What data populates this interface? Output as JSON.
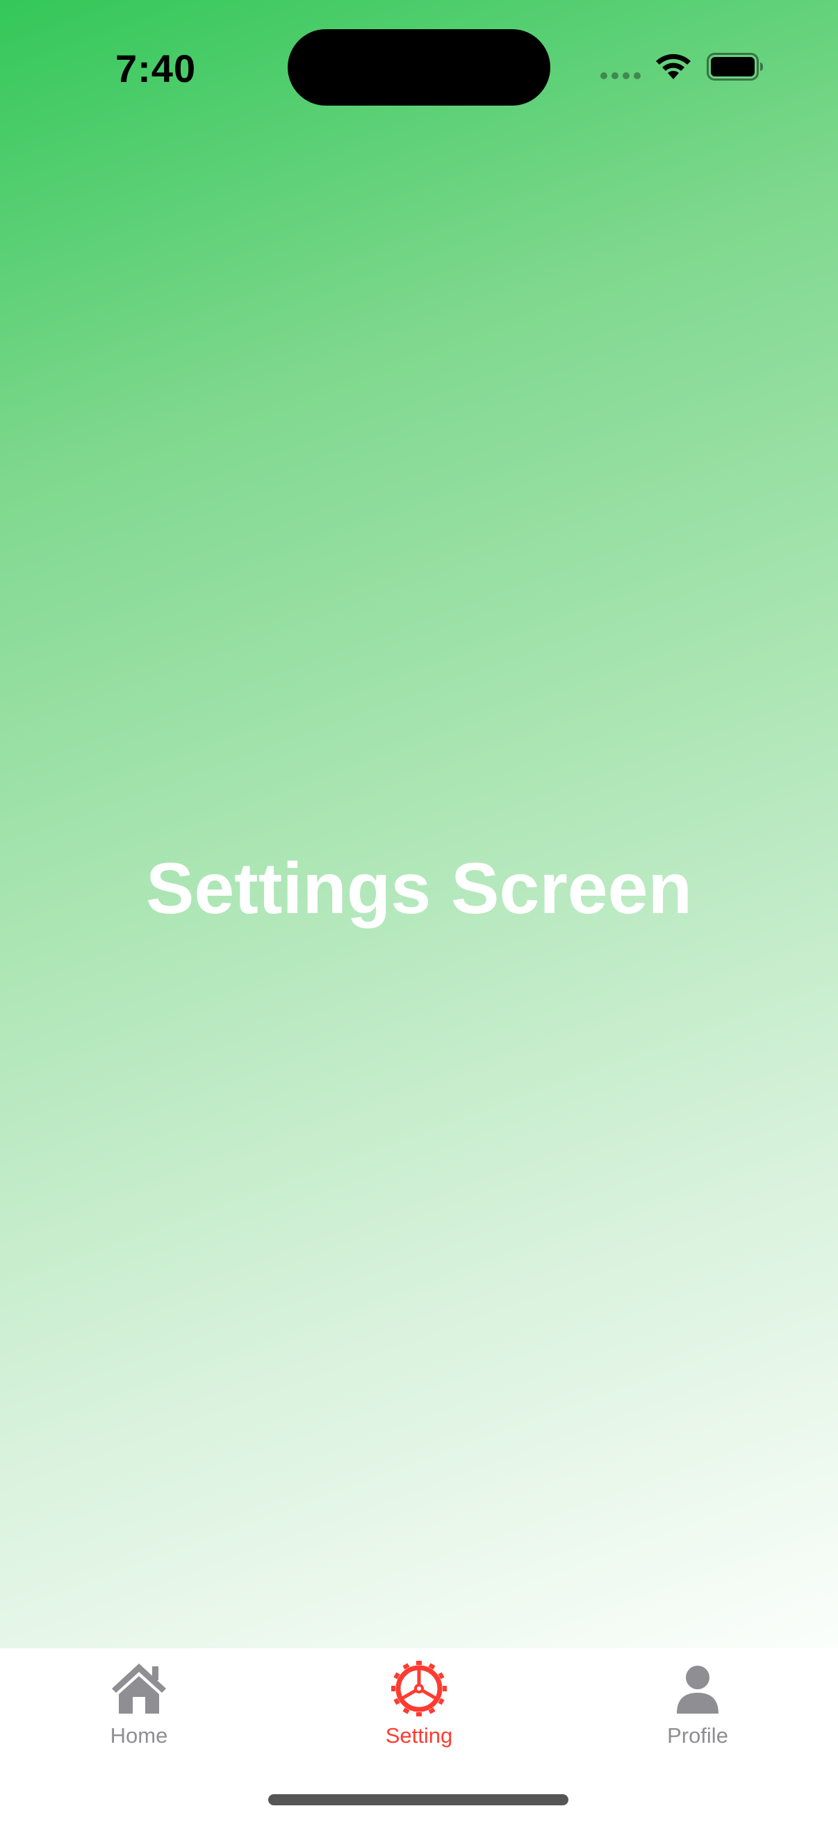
{
  "status_bar": {
    "time": "7:40"
  },
  "main": {
    "title": "Settings Screen",
    "gradient_colors": [
      "#34c759",
      "#ffffff"
    ]
  },
  "tab_bar": {
    "active_color": "#ff3b30",
    "inactive_color": "#8e8e93",
    "tabs": [
      {
        "label": "Home",
        "icon": "house-icon",
        "active": false
      },
      {
        "label": "Setting",
        "icon": "gear-icon",
        "active": true
      },
      {
        "label": "Profile",
        "icon": "person-icon",
        "active": false
      }
    ]
  }
}
